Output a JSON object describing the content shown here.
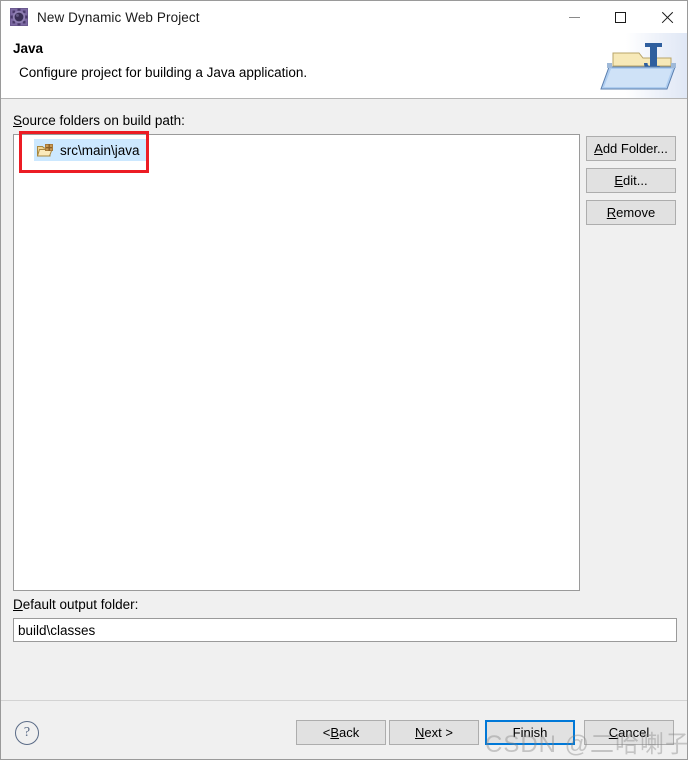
{
  "window": {
    "title": "New Dynamic Web Project",
    "icon": "gear-icon",
    "controls": {
      "minimize": "minimize-icon",
      "maximize": "maximize-icon",
      "close": "close-icon"
    }
  },
  "header": {
    "title": "Java",
    "description": "Configure project for building a Java application.",
    "banner_icon": "java-folder-icon"
  },
  "main": {
    "source_folders_label_prefix": "S",
    "source_folders_label_rest": "ource folders on build path:",
    "list_items": [
      {
        "icon": "package-folder-icon",
        "label": "src\\main\\java",
        "selected": true
      }
    ],
    "buttons": {
      "add_folder": {
        "accel": "A",
        "rest": "dd Folder..."
      },
      "edit": {
        "prefix": "",
        "accel": "E",
        "rest": "dit..."
      },
      "remove": {
        "accel": "R",
        "rest": "emove"
      }
    },
    "output_label_accel": "D",
    "output_label_rest": "efault output folder:",
    "output_value": "build\\classes"
  },
  "footer": {
    "help": "?",
    "back": {
      "prefix": "< ",
      "accel": "B",
      "rest": "ack"
    },
    "next": {
      "accel": "N",
      "rest": "ext >"
    },
    "finish": "Finish",
    "cancel": {
      "accel": "C",
      "rest": "ancel"
    }
  },
  "watermark": {
    "text": "CSDN @二哈喇子！"
  },
  "colors": {
    "accent": "#0078d7",
    "annotation": "#ec1c24",
    "selection": "#cce8ff",
    "body_bg": "#f0f0f0"
  }
}
